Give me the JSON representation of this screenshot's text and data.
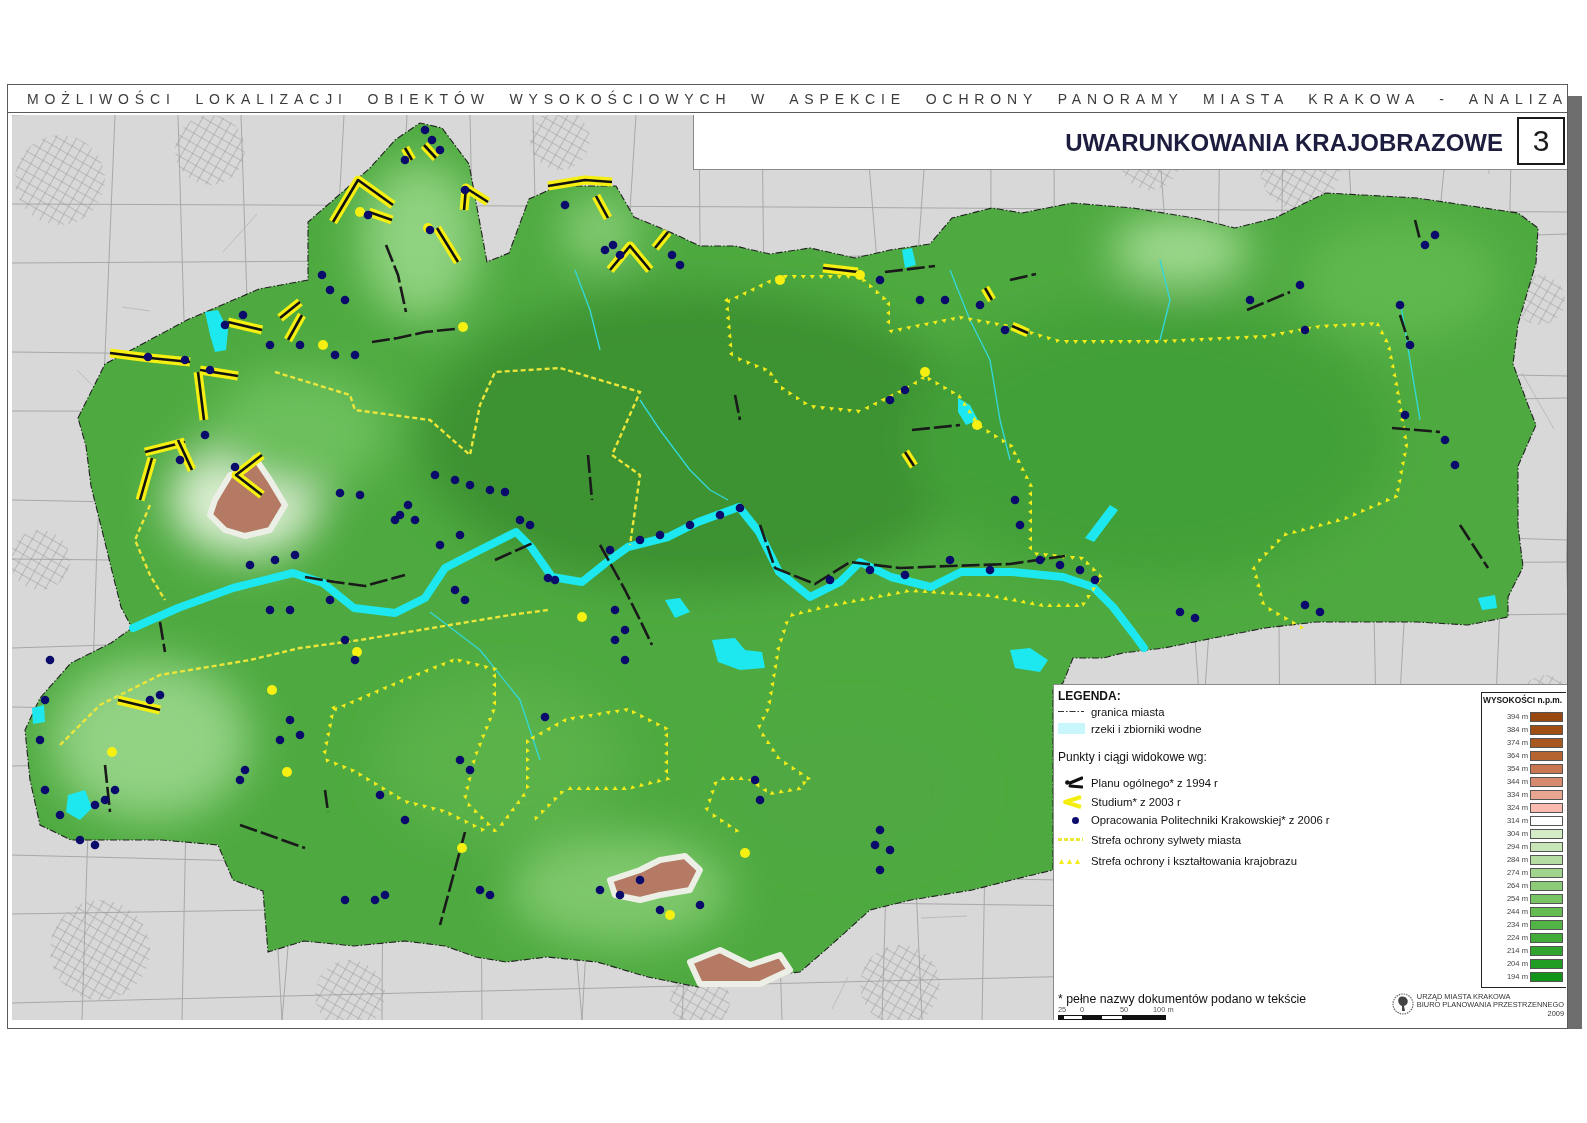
{
  "series_title": "MOŻLIWOŚCI LOKALIZACJI OBIEKTÓW WYSOKOŚCIOWYCH W ASPEKCIE OCHRONY PANORAMY MIASTA KRAKOWA - ANALIZA",
  "header": {
    "title": "UWARUNKOWANIA KRAJOBRAZOWE",
    "sheet_number": "3"
  },
  "legend": {
    "title": "LEGENDA:",
    "items": [
      {
        "kind": "boundary",
        "label": "granica miasta"
      },
      {
        "kind": "water",
        "label": "rzeki i zbiorniki wodne"
      },
      {
        "kind": "heading",
        "label": "Punkty i ciągi widokowe wg:"
      },
      {
        "kind": "axis",
        "label": "Planu ogólnego* z 1994 r"
      },
      {
        "kind": "corridor",
        "label": "Studium* z 2003 r"
      },
      {
        "kind": "point",
        "label": "Opracowania Politechniki Krakowskiej* z 2006 r"
      },
      {
        "kind": "dashed",
        "label": "Strefa ochrony sylwety miasta"
      },
      {
        "kind": "triangles",
        "label": "Strefa ochrony i kształtowania krajobrazu"
      }
    ],
    "footnote": "* pełne nazwy dokumentów podano w tekście",
    "scale_labels": [
      "25",
      "0",
      "50",
      "100 m"
    ]
  },
  "elevation_legend": {
    "title": "WYSOKOŚCI n.p.m.",
    "levels": [
      {
        "label": "394 m",
        "color": "#9a4a10"
      },
      {
        "label": "384 m",
        "color": "#a04f14"
      },
      {
        "label": "374 m",
        "color": "#a9581f"
      },
      {
        "label": "364 m",
        "color": "#b6642f"
      },
      {
        "label": "354 m",
        "color": "#c87752"
      },
      {
        "label": "344 m",
        "color": "#d68b6e"
      },
      {
        "label": "334 m",
        "color": "#e8a590"
      },
      {
        "label": "324 m",
        "color": "#fbbab0"
      },
      {
        "label": "314 m",
        "color": "#ffffff"
      },
      {
        "label": "304 m",
        "color": "#d5edc6"
      },
      {
        "label": "294 m",
        "color": "#c8e6b8"
      },
      {
        "label": "284 m",
        "color": "#b5dda2"
      },
      {
        "label": "274 m",
        "color": "#a1d48d"
      },
      {
        "label": "264 m",
        "color": "#8ccc79"
      },
      {
        "label": "254 m",
        "color": "#78c465"
      },
      {
        "label": "244 m",
        "color": "#64bc52"
      },
      {
        "label": "234 m",
        "color": "#51b445"
      },
      {
        "label": "224 m",
        "color": "#41ac39"
      },
      {
        "label": "214 m",
        "color": "#30a42d"
      },
      {
        "label": "204 m",
        "color": "#219c22"
      },
      {
        "label": "194 m",
        "color": "#12941a"
      }
    ]
  },
  "publisher": {
    "lines": [
      "URZĄD MIASTA KRAKOWA",
      "BIURO PLANOWANIA PRZESTRZENNEGO"
    ],
    "year": "2009"
  }
}
